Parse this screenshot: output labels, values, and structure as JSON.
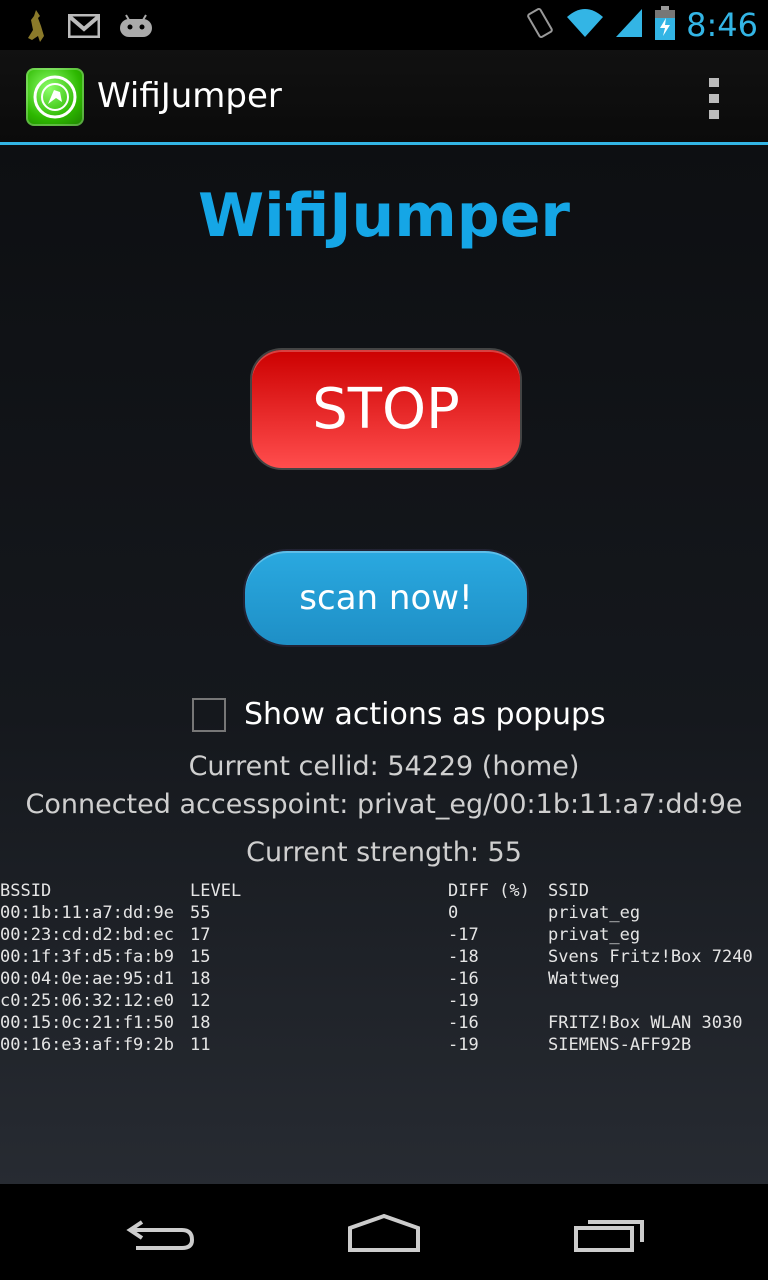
{
  "status_bar": {
    "left_icons": [
      "kangaroo-icon",
      "gmail-icon",
      "android-icon"
    ],
    "right_icons": [
      "vibrate-icon",
      "wifi-icon",
      "cell-signal-icon",
      "battery-charging-icon"
    ],
    "time": "8:46"
  },
  "action_bar": {
    "app_icon": "wifi-kangaroo-app-icon",
    "title": "WifiJumper",
    "overflow_icon": "overflow-menu-icon"
  },
  "main": {
    "heading": "WifiJumper",
    "stop_label": "STOP",
    "scan_label": "scan now!",
    "popup_checkbox_label": "Show actions as popups",
    "popup_checkbox_checked": false,
    "current_cellid": "Current cellid: 54229 (home)",
    "connected_ap": "Connected accesspoint: privat_eg/00:1b:11:a7:dd:9e",
    "current_strength": "Current strength: 55"
  },
  "table": {
    "headers": {
      "bssid": "BSSID",
      "level": "LEVEL",
      "diff": "DIFF (%)",
      "ssid": "SSID"
    },
    "rows": [
      {
        "bssid": "00:1b:11:a7:dd:9e",
        "level": "55",
        "diff": "0",
        "ssid": "privat_eg"
      },
      {
        "bssid": "00:23:cd:d2:bd:ec",
        "level": "17",
        "diff": "-17",
        "ssid": "privat_eg"
      },
      {
        "bssid": "00:1f:3f:d5:fa:b9",
        "level": "15",
        "diff": "-18",
        "ssid": "Svens Fritz!Box 7240"
      },
      {
        "bssid": "00:04:0e:ae:95:d1",
        "level": "18",
        "diff": "-16",
        "ssid": "Wattweg"
      },
      {
        "bssid": "c0:25:06:32:12:e0",
        "level": "12",
        "diff": "-19",
        "ssid": ""
      },
      {
        "bssid": "00:15:0c:21:f1:50",
        "level": "18",
        "diff": "-16",
        "ssid": "FRITZ!Box WLAN 3030"
      },
      {
        "bssid": "00:16:e3:af:f9:2b",
        "level": "11",
        "diff": "-19",
        "ssid": "SIEMENS-AFF92B"
      }
    ]
  },
  "nav_bar": {
    "back_icon": "back-icon",
    "home_icon": "home-icon",
    "recents_icon": "recent-apps-icon"
  },
  "colors": {
    "accent": "#33b5e5",
    "heading": "#15a6e6",
    "stop_button": "#e81c1c",
    "scan_button": "#2aa3dc"
  }
}
